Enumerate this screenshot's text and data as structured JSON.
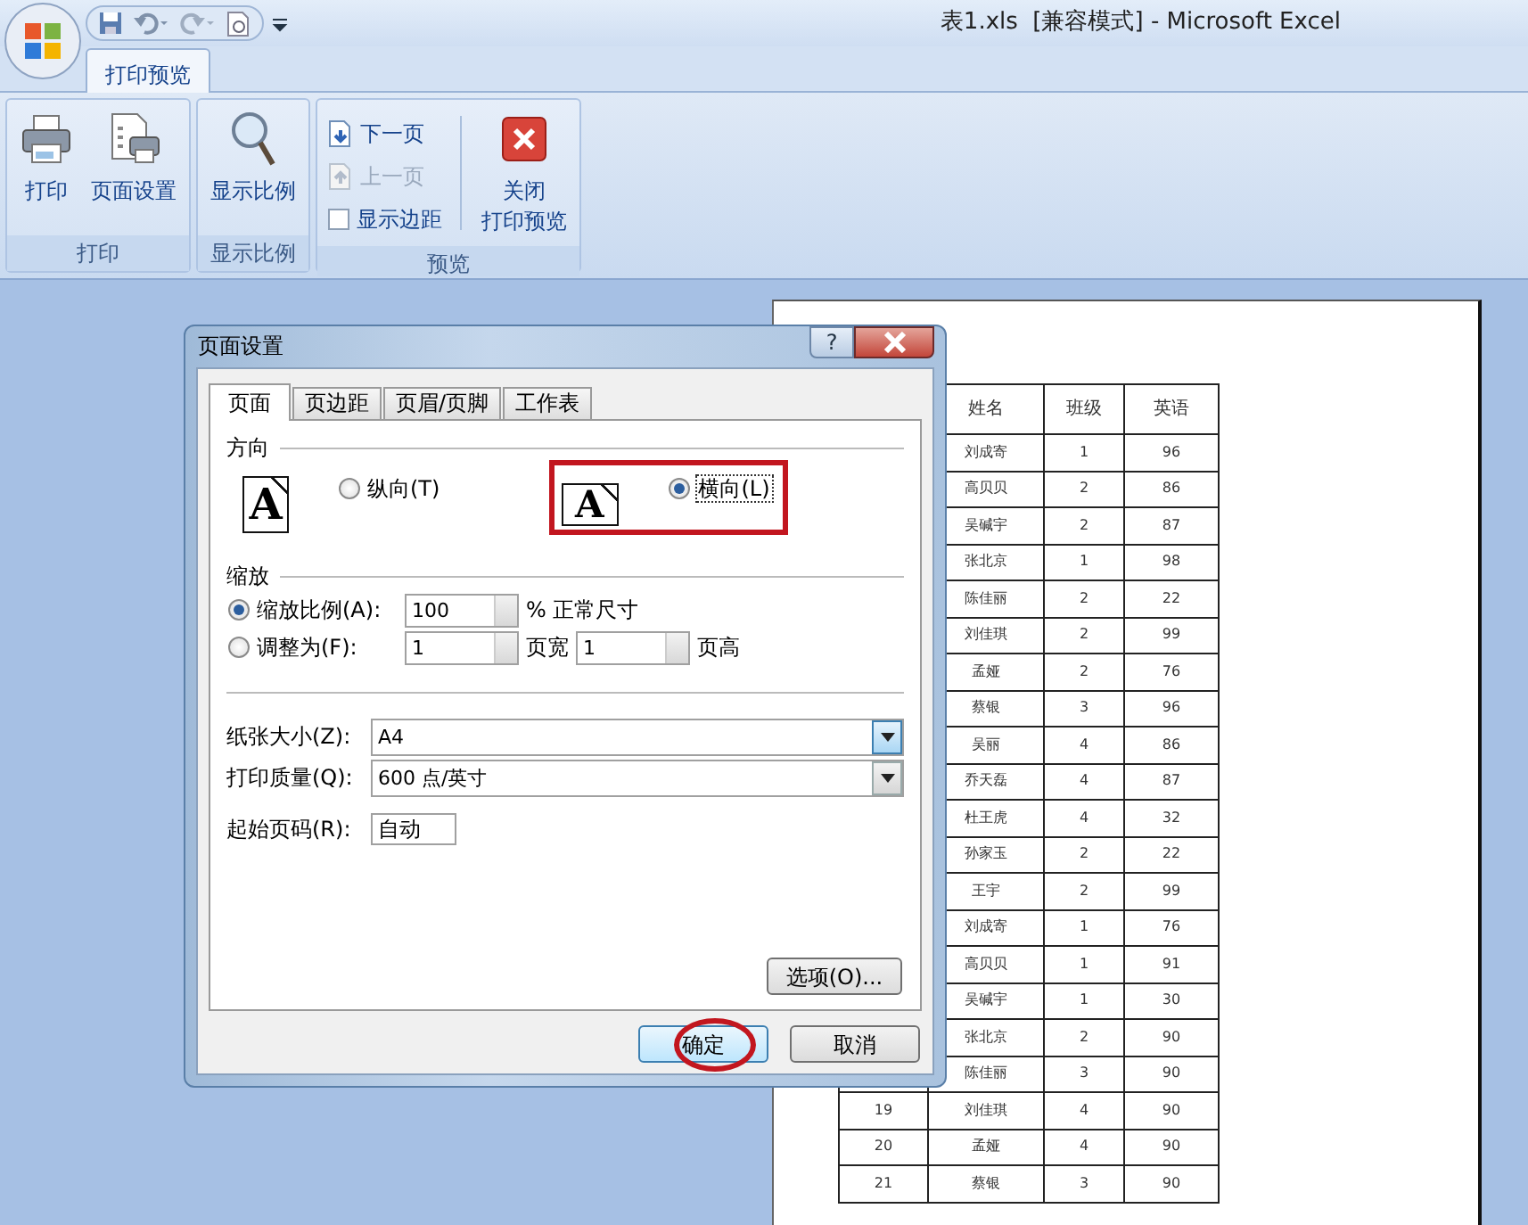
{
  "window": {
    "title": "表1.xls  [兼容模式] - Microsoft Excel"
  },
  "ribbon": {
    "tabs": [
      {
        "label": "打印预览",
        "selected": true
      }
    ],
    "groups": [
      {
        "label": "打印",
        "items": [
          {
            "kind": "large",
            "label_lines": [
              "打印"
            ]
          },
          {
            "kind": "large",
            "label_lines": [
              "页面设置"
            ]
          }
        ]
      },
      {
        "label": "显示比例",
        "items": [
          {
            "kind": "large",
            "label_lines": [
              "显示比例"
            ]
          }
        ]
      },
      {
        "label": "预览",
        "items": [
          {
            "kind": "small",
            "label": "下一页",
            "disabled": false
          },
          {
            "kind": "small",
            "label": "上一页",
            "disabled": true
          },
          {
            "kind": "checkbox",
            "label": "显示边距",
            "checked": false
          },
          {
            "kind": "large",
            "label_lines": [
              "关闭",
              "打印预览"
            ]
          }
        ]
      }
    ]
  },
  "dialog": {
    "title": "页面设置",
    "help_button": "?",
    "tabs": [
      {
        "label": "页面",
        "selected": true
      },
      {
        "label": "页边距",
        "selected": false
      },
      {
        "label": "页眉/页脚",
        "selected": false
      },
      {
        "label": "工作表",
        "selected": false
      }
    ],
    "orientation": {
      "heading": "方向",
      "options": [
        {
          "icon_letter": "A",
          "label": "纵向(T)",
          "selected": false,
          "highlighted": false
        },
        {
          "icon_letter": "A",
          "label": "横向(L)",
          "selected": true,
          "highlighted": true
        }
      ]
    },
    "scaling": {
      "heading": "缩放",
      "options": [
        {
          "label": "缩放比例(A):",
          "selected": true,
          "fields": [
            {
              "value": "100",
              "unit": "% 正常尺寸"
            }
          ]
        },
        {
          "label": "调整为(F):",
          "selected": false,
          "fields": [
            {
              "value": "1",
              "unit": "页宽"
            },
            {
              "value": "1",
              "unit": "页高"
            }
          ]
        }
      ]
    },
    "selects": [
      {
        "label": "纸张大小(Z):",
        "value": "A4",
        "highlighted": true
      },
      {
        "label": "打印质量(Q):",
        "value": "600 点/英寸",
        "highlighted": false
      }
    ],
    "first_page_number": {
      "label": "起始页码(R):",
      "value": "自动"
    },
    "options_button": "选项(O)...",
    "buttons": [
      {
        "label": "确定",
        "default": true,
        "circled": true
      },
      {
        "label": "取消",
        "default": false,
        "circled": false
      }
    ]
  },
  "sheet": {
    "columns": [
      "姓名",
      "班级",
      "英语"
    ],
    "rows": [
      {
        "name": "刘成寄",
        "class": "1",
        "english": "96"
      },
      {
        "name": "高贝贝",
        "class": "2",
        "english": "86"
      },
      {
        "name": "吴碱宇",
        "class": "2",
        "english": "87"
      },
      {
        "name": "张北京",
        "class": "1",
        "english": "98"
      },
      {
        "name": "陈佳丽",
        "class": "2",
        "english": "22"
      },
      {
        "name": "刘佳琪",
        "class": "2",
        "english": "99"
      },
      {
        "name": "孟娅",
        "class": "2",
        "english": "76"
      },
      {
        "name": "蔡银",
        "class": "3",
        "english": "96"
      },
      {
        "name": "吴丽",
        "class": "4",
        "english": "86"
      },
      {
        "name": "乔天磊",
        "class": "4",
        "english": "87"
      },
      {
        "name": "杜王虎",
        "class": "4",
        "english": "32"
      },
      {
        "name": "孙家玉",
        "class": "2",
        "english": "22"
      },
      {
        "name": "王宇",
        "class": "2",
        "english": "99"
      },
      {
        "name": "刘成寄",
        "class": "1",
        "english": "76"
      },
      {
        "name": "高贝贝",
        "class": "1",
        "english": "91"
      },
      {
        "name": "吴碱宇",
        "class": "1",
        "english": "30"
      },
      {
        "name": "张北京",
        "class": "2",
        "english": "90"
      },
      {
        "name": "陈佳丽",
        "class": "3",
        "english": "90"
      },
      {
        "number": "19",
        "name": "刘佳琪",
        "class": "4",
        "english": "90"
      },
      {
        "number": "20",
        "name": "孟娅",
        "class": "4",
        "english": "90"
      },
      {
        "number": "21",
        "name": "蔡银",
        "class": "3",
        "english": "90"
      }
    ]
  }
}
